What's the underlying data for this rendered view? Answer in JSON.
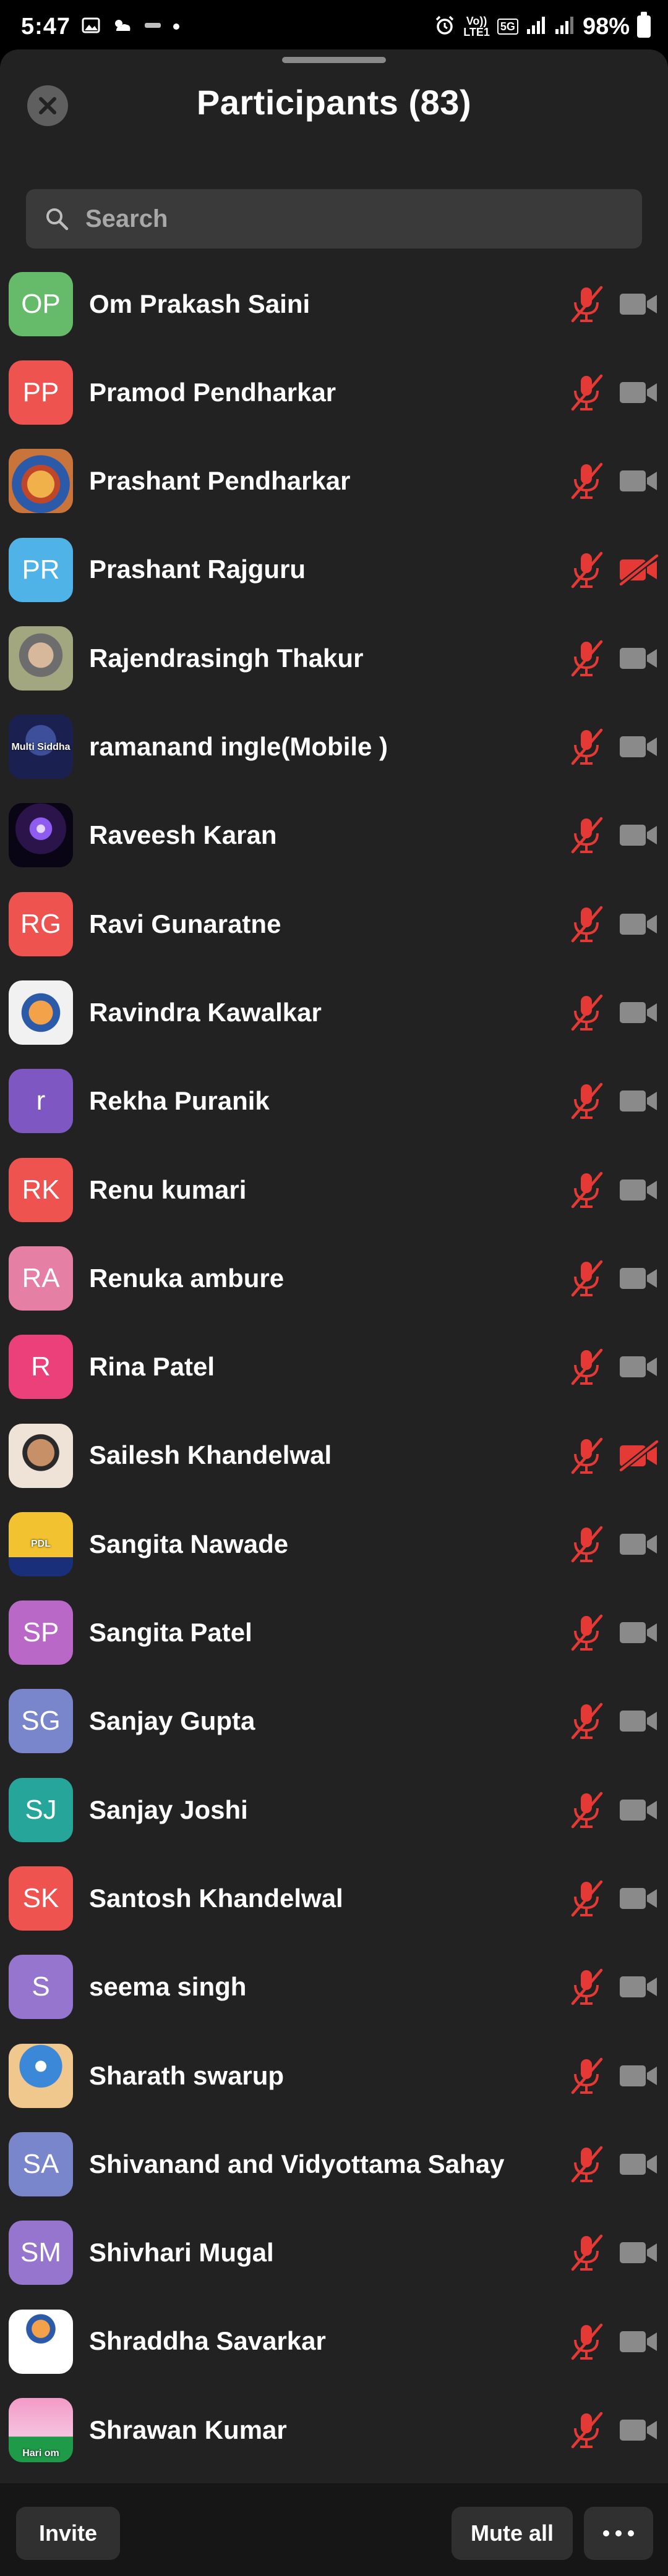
{
  "status_bar": {
    "time": "5:47",
    "battery": "98%",
    "network_top": "Vo))",
    "network_bottom": "LTE1",
    "network_type": "5G"
  },
  "header": {
    "title": "Participants (83)"
  },
  "search": {
    "placeholder": "Search"
  },
  "colors": {
    "sheet_background": "#222222",
    "muted_red": "#e53935",
    "camera_gray": "#8a8a8a"
  },
  "participants": [
    {
      "name": "Om Prakash Saini",
      "initials": "OP",
      "avatar_color": "#66bb6a",
      "mic": "muted",
      "video": "off"
    },
    {
      "name": "Pramod Pendharkar",
      "initials": "PP",
      "avatar_color": "#ef5350",
      "mic": "muted",
      "video": "off"
    },
    {
      "name": "Prashant Pendharkar",
      "initials": "",
      "avatar_style": "av-prashant",
      "mic": "muted",
      "video": "off"
    },
    {
      "name": "Prashant Rajguru",
      "initials": "PR",
      "avatar_color": "#4fb3e8",
      "mic": "muted",
      "video": "blocked"
    },
    {
      "name": "Rajendrasingh Thakur",
      "initials": "",
      "avatar_style": "av-rajendra",
      "mic": "muted",
      "video": "off"
    },
    {
      "name": "ramanand ingle(Mobile )",
      "initials": "",
      "avatar_style": "av-ramanand",
      "avatar_text": "Multi Siddha",
      "mic": "muted",
      "video": "off"
    },
    {
      "name": "Raveesh Karan",
      "initials": "",
      "avatar_style": "av-raveesh",
      "mic": "muted",
      "video": "off"
    },
    {
      "name": "Ravi Gunaratne",
      "initials": "RG",
      "avatar_color": "#ef5350",
      "mic": "muted",
      "video": "off"
    },
    {
      "name": "Ravindra Kawalkar",
      "initials": "",
      "avatar_style": "av-ravindra",
      "mic": "muted",
      "video": "off"
    },
    {
      "name": "Rekha Puranik",
      "initials": "r",
      "avatar_color": "#7e57c2",
      "mic": "muted",
      "video": "off"
    },
    {
      "name": "Renu kumari",
      "initials": "RK",
      "avatar_color": "#ef5350",
      "mic": "muted",
      "video": "off"
    },
    {
      "name": "Renuka ambure",
      "initials": "RA",
      "avatar_color": "#e57fa4",
      "mic": "muted",
      "video": "off"
    },
    {
      "name": "Rina Patel",
      "initials": "R",
      "avatar_color": "#ec407a",
      "mic": "muted",
      "video": "off"
    },
    {
      "name": "Sailesh Khandelwal",
      "initials": "",
      "avatar_style": "av-sailesh",
      "mic": "muted",
      "video": "blocked"
    },
    {
      "name": "Sangita Nawade",
      "initials": "",
      "avatar_style": "av-sangita-n",
      "avatar_text": "PDL",
      "mic": "muted",
      "video": "off"
    },
    {
      "name": "Sangita Patel",
      "initials": "SP",
      "avatar_color": "#ba68c8",
      "mic": "muted",
      "video": "off"
    },
    {
      "name": "Sanjay Gupta",
      "initials": "SG",
      "avatar_color": "#7986cb",
      "mic": "muted",
      "video": "off"
    },
    {
      "name": "Sanjay Joshi",
      "initials": "SJ",
      "avatar_color": "#26a69a",
      "mic": "muted",
      "video": "off"
    },
    {
      "name": "Santosh Khandelwal",
      "initials": "SK",
      "avatar_color": "#ef5350",
      "mic": "muted",
      "video": "off"
    },
    {
      "name": "seema  singh",
      "initials": "S",
      "avatar_color": "#9575cd",
      "mic": "muted",
      "video": "off"
    },
    {
      "name": "Sharath swarup",
      "initials": "",
      "avatar_style": "av-sharath",
      "mic": "muted",
      "video": "off"
    },
    {
      "name": "Shivanand and Vidyottama Sahay",
      "initials": "SA",
      "avatar_color": "#7986cb",
      "mic": "muted",
      "video": "off"
    },
    {
      "name": "Shivhari Mugal",
      "initials": "SM",
      "avatar_color": "#9575cd",
      "mic": "muted",
      "video": "off"
    },
    {
      "name": "Shraddha Savarkar",
      "initials": "",
      "avatar_style": "av-shraddha",
      "mic": "muted",
      "video": "off"
    },
    {
      "name": "Shrawan Kumar",
      "initials": "",
      "avatar_style": "av-shrawan",
      "avatar_text": "Hari om",
      "mic": "muted",
      "video": "off"
    }
  ],
  "bottom_bar": {
    "invite_label": "Invite",
    "mute_all_label": "Mute all",
    "more_icon": "more-horizontal-icon"
  }
}
